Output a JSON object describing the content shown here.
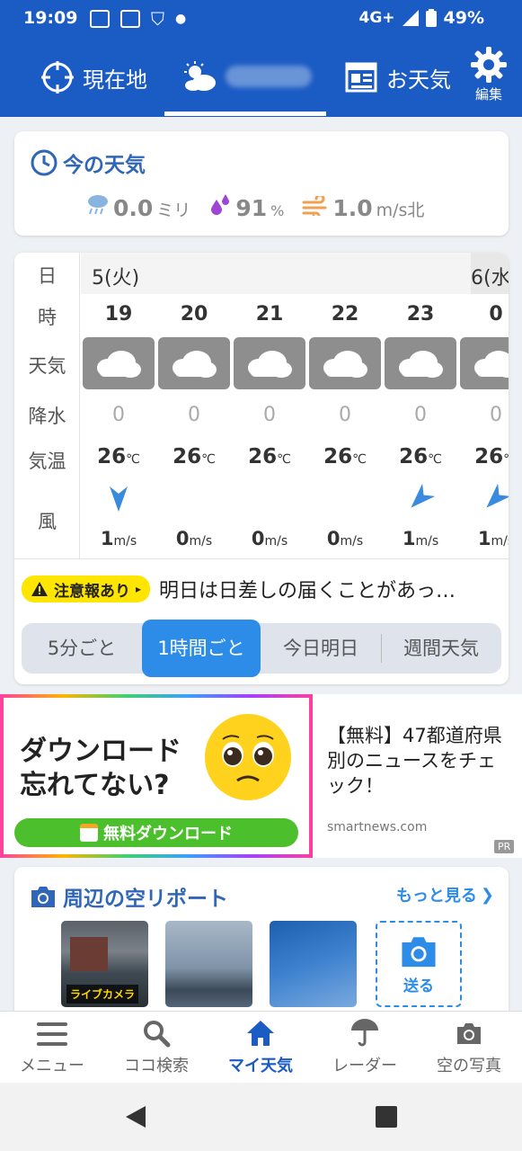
{
  "status_bar": {
    "time": "19:09",
    "network": "4G+",
    "battery": "49%"
  },
  "top_nav": {
    "current_location_label": "現在地",
    "forecast_label": "お天気",
    "edit_label": "編集"
  },
  "current_weather": {
    "title": "今の天気",
    "precip_value": "0.0",
    "precip_unit": "ミリ",
    "humidity_value": "91",
    "humidity_unit": "%",
    "wind_value": "1.0",
    "wind_unit": "m/s北"
  },
  "hourly": {
    "row_labels": {
      "day": "日",
      "hour": "時",
      "weather": "天気",
      "precip": "降水",
      "temp": "気温",
      "wind": "風"
    },
    "day_current": "5(火)",
    "day_next": "6(水",
    "hours": [
      "19",
      "20",
      "21",
      "22",
      "23",
      "0"
    ],
    "precip": [
      "0",
      "0",
      "0",
      "0",
      "0",
      "0"
    ],
    "temps": [
      "26",
      "26",
      "26",
      "26",
      "26",
      "26"
    ],
    "temp_unit": "℃",
    "winds": [
      "1",
      "0",
      "0",
      "0",
      "1",
      "1"
    ],
    "wind_unit": "m/s"
  },
  "alert": {
    "badge": "注意報あり",
    "text": "明日は日差しの届くことがあっ…"
  },
  "segments": [
    "5分ごと",
    "1時間ごと",
    "今日明日",
    "週間天気"
  ],
  "ad": {
    "headline_1": "ダウンロード",
    "headline_2": "忘れてない?",
    "button": "無料ダウンロード",
    "title": "【無料】47都道府県別のニュースをチェック！",
    "domain": "smartnews.com",
    "pr": "PR"
  },
  "sky_report": {
    "title": "周辺の空リポート",
    "more": "もっと見る",
    "live_label": "ライブカメラ",
    "send_label": "送る"
  },
  "bottom_nav": [
    "メニュー",
    "ココ検索",
    "マイ天気",
    "レーダー",
    "空の写真"
  ],
  "colors": {
    "brand_blue": "#1b5bc4",
    "active_blue": "#2d8ce8",
    "alert_yellow": "#ffe600"
  }
}
